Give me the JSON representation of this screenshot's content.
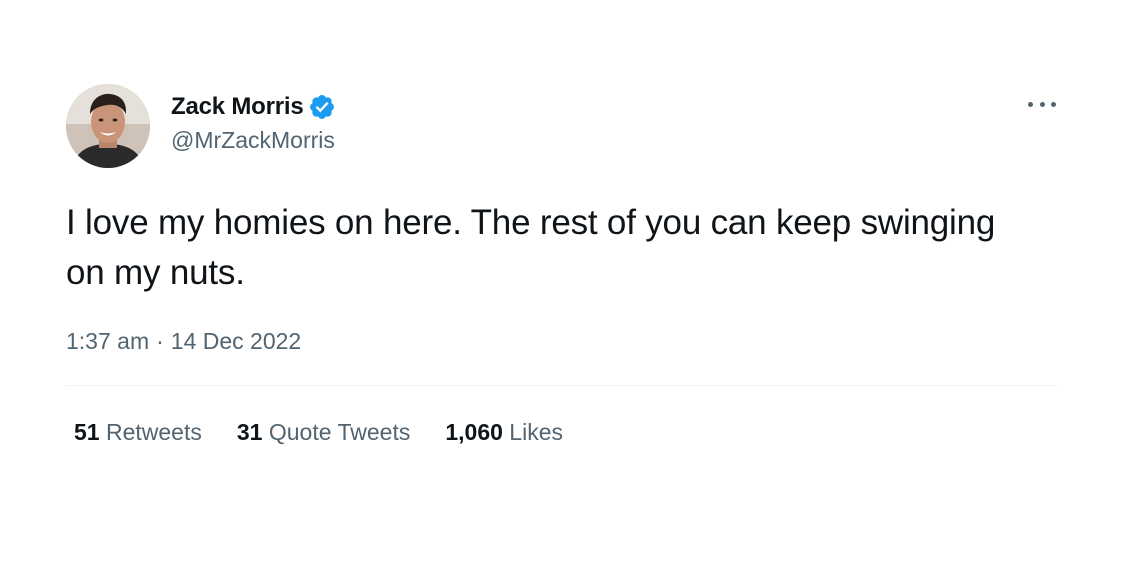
{
  "tweet": {
    "author": {
      "display_name": "Zack Morris",
      "handle": "@MrZackMorris",
      "verified": true,
      "verified_icon": "verified-badge-icon",
      "avatar": "profile-photo"
    },
    "more_icon": "more-options-icon",
    "text": "I love my homies on here. The rest of you can keep swinging on my nuts.",
    "time": "1:37 am",
    "separator": "·",
    "date": "14 Dec 2022",
    "stats": {
      "retweets": {
        "count": "51",
        "label": "Retweets"
      },
      "quotes": {
        "count": "31",
        "label": "Quote Tweets"
      },
      "likes": {
        "count": "1,060",
        "label": "Likes"
      }
    }
  },
  "colors": {
    "text_primary": "#0f1419",
    "text_secondary": "#536471",
    "verified_blue": "#1d9bf0",
    "divider": "#eff3f4",
    "background": "#ffffff"
  }
}
